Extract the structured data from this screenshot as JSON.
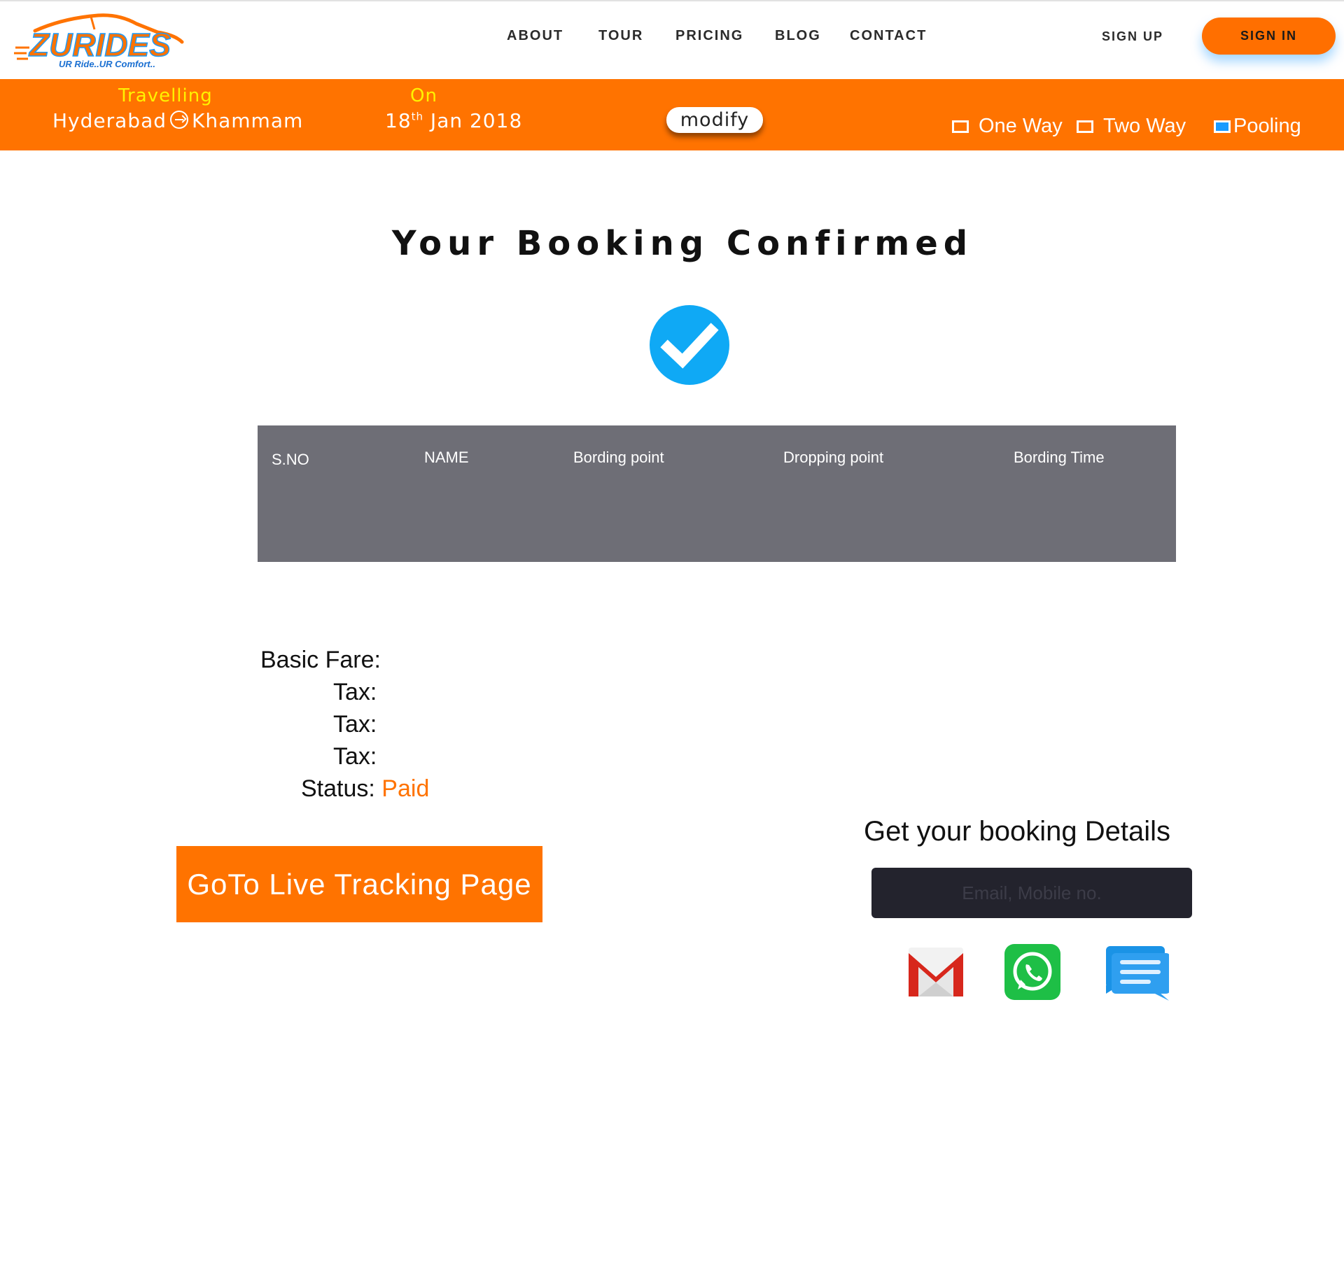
{
  "header": {
    "logo_text": "ZURIDES",
    "logo_tagline": "UR Ride..UR Comfort..",
    "nav": [
      "ABOUT",
      "TOUR",
      "PRICING",
      "BLOG",
      "CONTACT"
    ],
    "signup_label": "SIGN UP",
    "signin_label": "SIGN IN"
  },
  "trip": {
    "travelling_label": "Travelling",
    "from": "Hyderabad",
    "to": "Khammam",
    "on_label": "On",
    "date_day": "18",
    "date_suffix": "th",
    "date_rest": " Jan 2018",
    "modify_label": "modify",
    "options": [
      {
        "label": "One Way",
        "checked": false
      },
      {
        "label": "Two Way",
        "checked": false
      },
      {
        "label": "Pooling",
        "checked": true
      }
    ]
  },
  "main": {
    "title": "Your Booking Confirmed",
    "table_headers": [
      "S.NO",
      "NAME",
      "Bording point",
      "Dropping point",
      "Bording Time"
    ],
    "fare_labels": {
      "basic": "Basic Fare:",
      "tax1": "Tax:",
      "tax2": "Tax:",
      "tax3": "Tax:",
      "status": "Status:",
      "status_value": "Paid"
    },
    "track_button": "GoTo Live Tracking Page",
    "details_title": "Get your booking Details",
    "details_placeholder": "Email, Mobile no.",
    "share_icons": [
      "gmail-icon",
      "whatsapp-icon",
      "message-icon"
    ]
  },
  "colors": {
    "brand_orange": "#ff7300",
    "check_blue": "#0fa9f5",
    "table_gray": "#6e6e76",
    "input_dark": "#23232d"
  }
}
